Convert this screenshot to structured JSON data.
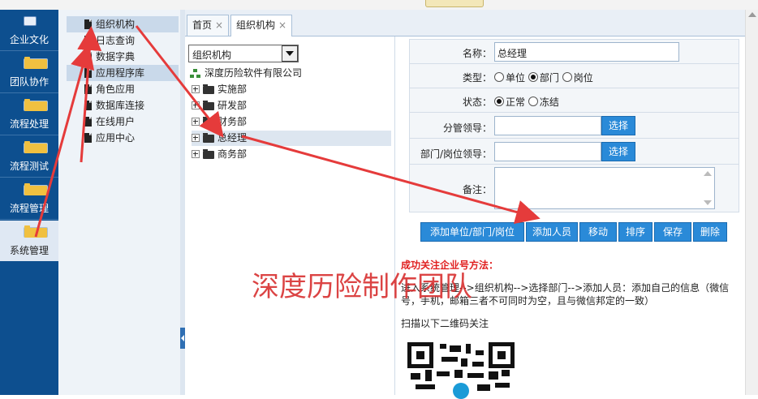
{
  "left_nav": {
    "items": [
      {
        "label": "企业文化",
        "icon": "id-card-icon"
      },
      {
        "label": "团队协作",
        "icon": "folder-icon"
      },
      {
        "label": "流程处理",
        "icon": "folder-icon"
      },
      {
        "label": "流程测试",
        "icon": "folder-icon"
      },
      {
        "label": "流程管理",
        "icon": "folder-icon"
      },
      {
        "label": "系统管理",
        "icon": "folder-icon",
        "active": true
      }
    ]
  },
  "submenu": {
    "items": [
      {
        "label": "组织机构",
        "selected": true
      },
      {
        "label": "日志查询"
      },
      {
        "label": "数据字典"
      },
      {
        "label": "应用程序库",
        "selected": true
      },
      {
        "label": "角色应用"
      },
      {
        "label": "数据库连接"
      },
      {
        "label": "在线用户"
      },
      {
        "label": "应用中心"
      }
    ]
  },
  "tabs": [
    {
      "label": "首页",
      "close": "×"
    },
    {
      "label": "组织机构",
      "close": "×",
      "active": true
    }
  ],
  "tree": {
    "view_select": "组织机构",
    "root": "深度历险软件有限公司",
    "nodes": [
      "实施部",
      "研发部",
      "财务部",
      "总经理",
      "商务部"
    ],
    "selected": "总经理"
  },
  "form": {
    "name": {
      "label": "名称：",
      "value": "总经理"
    },
    "type": {
      "label": "类型：",
      "options": [
        "单位",
        "部门",
        "岗位"
      ],
      "selected": "部门"
    },
    "status": {
      "label": "状态：",
      "options": [
        "正常",
        "冻结"
      ],
      "selected": "正常"
    },
    "supervisor": {
      "label": "分管领导：",
      "value": "",
      "button": "选择"
    },
    "leader": {
      "label": "部门/岗位领导：",
      "value": "",
      "button": "选择"
    },
    "remark": {
      "label": "备注：",
      "value": ""
    }
  },
  "actions": [
    "添加单位/部门/岗位",
    "添加人员",
    "移动",
    "排序",
    "保存",
    "删除"
  ],
  "instructions": {
    "title": "成功关注企业号方法：",
    "body1": "进入系统管理-->组织机构-->选择部门-->添加人员：添加自己的信息（微信",
    "body2": "号，手机，邮箱三者不可同时为空，且与微信邦定的一致）",
    "scan": "扫描以下二维码关注"
  },
  "watermark": "深度历险制作团队",
  "colors": {
    "nav_bg": "#0d4f8f",
    "button_blue": "#2a8ad8",
    "annotation_red": "#e53b3b"
  }
}
